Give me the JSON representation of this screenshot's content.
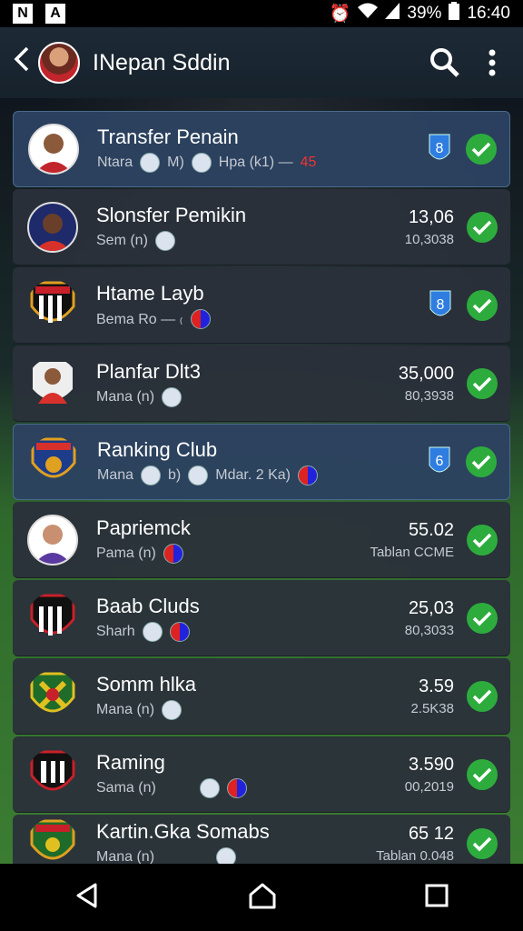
{
  "status": {
    "signal_left": "N",
    "signal_left2": "A",
    "battery": "39%",
    "time": "16:40"
  },
  "appbar": {
    "title": "INepan Sddin"
  },
  "rows": [
    {
      "name": "Transfer Penain",
      "sub1": "Ntara",
      "sub2": "M)",
      "sub3": "Hpa (k1) —",
      "sub4": "45",
      "right1": "",
      "right2": "",
      "shield": "8",
      "crest": "player",
      "hl": true
    },
    {
      "name": "Slonsfer Pemikin",
      "sub1": "Sem (n)",
      "right1": "13,06",
      "right2": "10,3038",
      "crest": "player-dark"
    },
    {
      "name": "Htame Layb",
      "sub1": "Bema Ro — ₍",
      "shield": "8",
      "crest": "club-stripes"
    },
    {
      "name": "Planfar Dlt3",
      "sub1": "Mana (n)",
      "right1": "35,000",
      "right2": "80,3938",
      "crest": "player-red"
    },
    {
      "name": "Ranking Club",
      "sub1": "Mana",
      "sub2": "b)",
      "sub3": "Mdar. 2 Ka)",
      "shield": "6",
      "crest": "club-blue",
      "hl": true
    },
    {
      "name": "Papriemck",
      "sub1": "Pama (n)",
      "right1": "55.02",
      "right2": "Tablan CCME",
      "crest": "player-purple"
    },
    {
      "name": "Baab Cluds",
      "sub1": "Sharh",
      "right1": "25,03",
      "right2": "80,3033",
      "crest": "club-stripes"
    },
    {
      "name": "Somm hlka",
      "sub1": "Mana (n)",
      "right1": "3.59",
      "right2": "2.5K38",
      "crest": "club-green"
    },
    {
      "name": "Raming",
      "sub1": "Sama (n)",
      "right1": "3.590",
      "right2": "00,2019",
      "crest": "club-stripes2"
    },
    {
      "name": "Kartin.Gka Somabs",
      "sub1": "Mana (n)",
      "right1": "65 12",
      "right2": "Tablan 0.048",
      "crest": "club-green2"
    }
  ]
}
